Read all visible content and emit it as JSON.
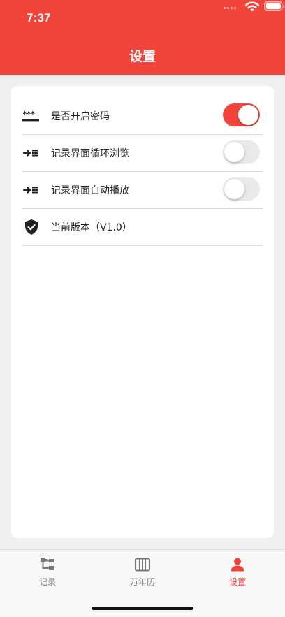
{
  "status_bar": {
    "time": "7:37"
  },
  "header": {
    "title": "设置"
  },
  "colors": {
    "accent": "#f2443a",
    "toggle_off": "#e9e9eb"
  },
  "settings": {
    "items": [
      {
        "label": "是否开启密码",
        "icon": "password-dots-icon",
        "toggle": true
      },
      {
        "label": "记录界面循环浏览",
        "icon": "indent-list-icon",
        "toggle": false
      },
      {
        "label": "记录界面自动播放",
        "icon": "indent-list-icon",
        "toggle": false
      },
      {
        "label": "当前版本（V1.0）",
        "icon": "shield-check-icon"
      }
    ]
  },
  "tabbar": {
    "tabs": [
      {
        "label": "记录",
        "icon": "tree-icon",
        "active": false
      },
      {
        "label": "万年历",
        "icon": "calendar-columns-icon",
        "active": false
      },
      {
        "label": "设置",
        "icon": "person-icon",
        "active": true
      }
    ]
  }
}
